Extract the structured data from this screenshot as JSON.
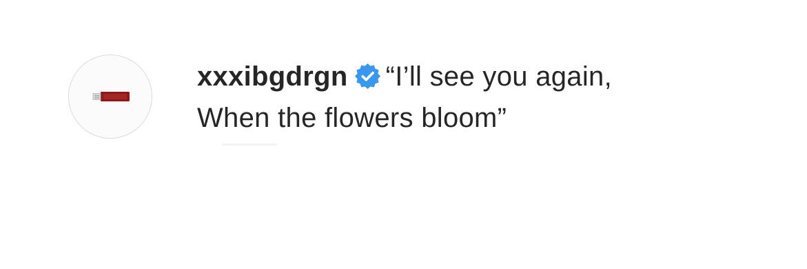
{
  "comment": {
    "username": "xxxibgdrgn",
    "verified_icon": "verified-badge-icon",
    "text_line1": "“I’ll see you again,",
    "text_line2": "When the flowers bloom”"
  },
  "avatar": {
    "icon": "usb-drive-icon"
  },
  "colors": {
    "text": "#262626",
    "verified": "#3897f0",
    "avatar_border": "#dbdbdb",
    "avatar_mark": "#8b1a1a"
  }
}
